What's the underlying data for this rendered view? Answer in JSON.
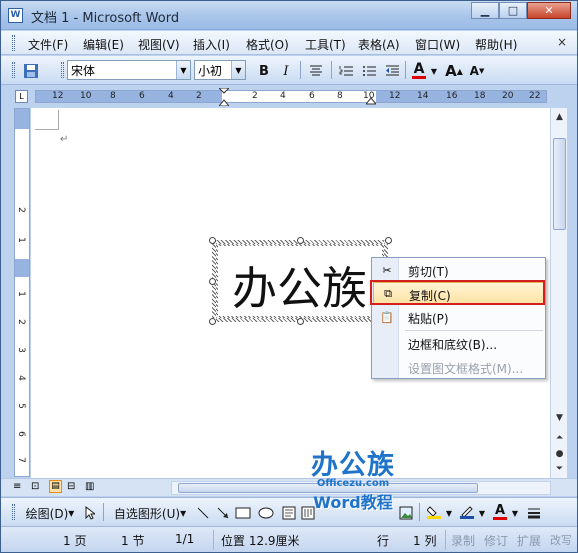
{
  "window": {
    "title": "文档 1 - Microsoft Word",
    "app_icon_glyph": "W",
    "buttons": {
      "minimize": "▁",
      "maximize": "□",
      "close": "✕"
    }
  },
  "menubar": {
    "items": [
      "文件(F)",
      "编辑(E)",
      "视图(V)",
      "插入(I)",
      "格式(O)",
      "工具(T)",
      "表格(A)",
      "窗口(W)",
      "帮助(H)"
    ],
    "close_doc": "×"
  },
  "toolbar": {
    "font_name": "宋体",
    "font_size": "小初",
    "bold": "B",
    "italic": "I",
    "font_color_label": "A",
    "grow_font": "A",
    "shrink_font": "A"
  },
  "ruler": {
    "ticks": [
      "12",
      "10",
      "8",
      "6",
      "4",
      "2",
      "2",
      "4",
      "6",
      "8",
      "10",
      "12",
      "14",
      "16",
      "18",
      "20",
      "22"
    ]
  },
  "vruler": {
    "ticks": [
      "2",
      "1",
      "1",
      "2",
      "3",
      "4",
      "5",
      "6",
      "7"
    ]
  },
  "document": {
    "paragraph_mark": "↵",
    "textbox_text": "办公族"
  },
  "context_menu": {
    "items": [
      {
        "label": "剪切(T)",
        "icon": "scissors-icon",
        "glyph": "✂",
        "disabled": false
      },
      {
        "label": "复制(C)",
        "icon": "copy-icon",
        "glyph": "⧉",
        "disabled": false,
        "highlighted": true
      },
      {
        "label": "粘贴(P)",
        "icon": "paste-icon",
        "glyph": "📋",
        "disabled": false
      },
      {
        "label": "边框和底纹(B)...",
        "icon": "",
        "glyph": "",
        "disabled": false
      },
      {
        "label": "设置图文框格式(M)...",
        "icon": "",
        "glyph": "",
        "disabled": true
      }
    ]
  },
  "drawbar": {
    "draw_label": "绘图(D)",
    "autoshapes_label": "自选图形(U)"
  },
  "statusbar": {
    "page": "1 页",
    "section": "1 节",
    "page_of": "1/1",
    "position": "位置 12.9厘米",
    "line": "行",
    "column": "1 列",
    "rec": "录制",
    "trk": "修订",
    "ext": "扩展",
    "ovr": "改写"
  },
  "watermark": {
    "line1": "办公族",
    "line2": "Officezu.com",
    "line3": "Word教程"
  },
  "colors": {
    "highlight_border": "#d51f1f",
    "watermark": "#1f74c9"
  }
}
